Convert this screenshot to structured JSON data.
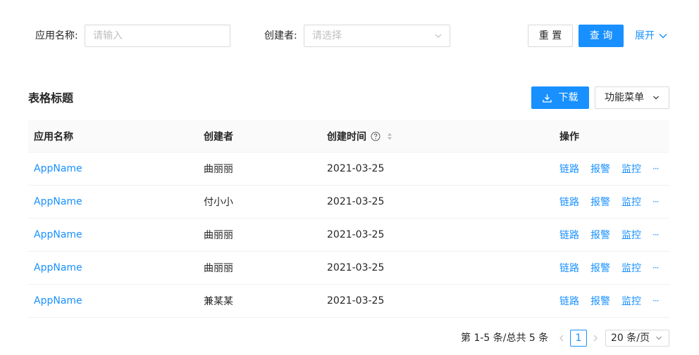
{
  "filters": {
    "app_name_label": "应用名称:",
    "app_name_placeholder": "请输入",
    "creator_label": "创建者:",
    "creator_placeholder": "请选择",
    "reset_label": "重 置",
    "query_label": "查 询",
    "expand_label": "展开"
  },
  "table_header": {
    "title": "表格标题",
    "download_label": "下载",
    "menu_label": "功能菜单"
  },
  "columns": [
    "应用名称",
    "创建者",
    "创建时间",
    "操作"
  ],
  "rows": [
    {
      "app": "AppName",
      "creator": "曲丽丽",
      "time": "2021-03-25"
    },
    {
      "app": "AppName",
      "creator": "付小小",
      "time": "2021-03-25"
    },
    {
      "app": "AppName",
      "creator": "曲丽丽",
      "time": "2021-03-25"
    },
    {
      "app": "AppName",
      "creator": "曲丽丽",
      "time": "2021-03-25"
    },
    {
      "app": "AppName",
      "creator": "兼某某",
      "time": "2021-03-25"
    }
  ],
  "actions": {
    "trace": "链路",
    "alert": "报警",
    "monitor": "监控",
    "more": "···"
  },
  "pagination": {
    "info": "第 1-5 条/总共 5 条",
    "current_page": "1",
    "page_size": "20 条/页"
  },
  "colors": {
    "primary": "#1890ff",
    "border": "#d9d9d9",
    "header_bg": "#fafafa"
  }
}
